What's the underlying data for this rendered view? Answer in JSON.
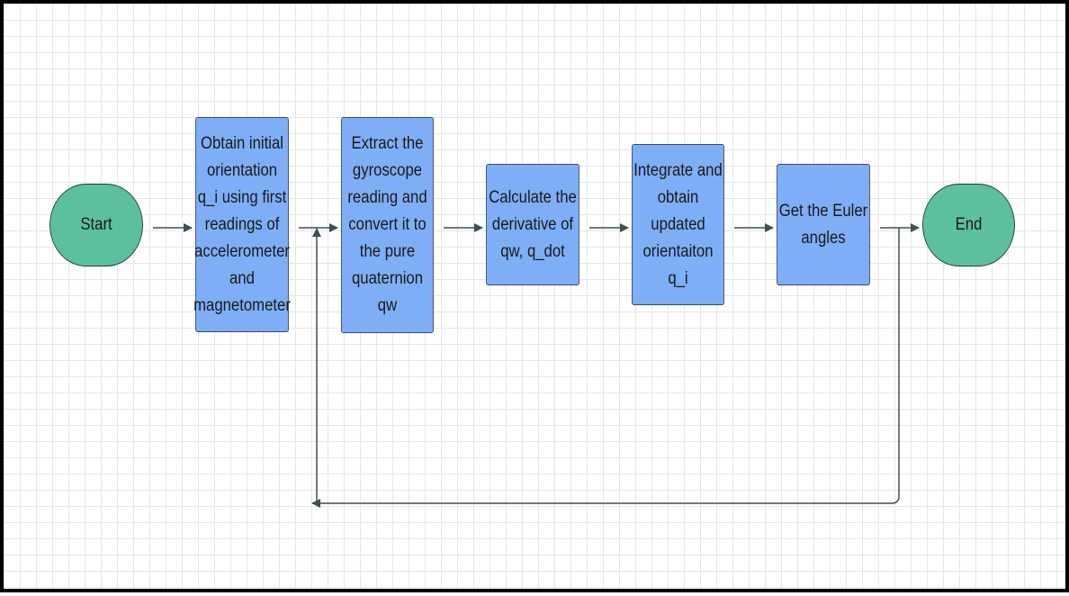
{
  "colors": {
    "terminal_fill": "#5cbf9f",
    "process_fill": "#7eaef5",
    "connector": "#3f4f55",
    "grid": "#e6e6e6"
  },
  "nodes": {
    "start": "Start",
    "step1": "Obtain initial\norientation\nq_i using first\nreadings of\naccelerometer\nand\nmagnetometer",
    "step2": "Extract the\ngyroscope\nreading and\nconvert it to\nthe pure\nquaternion\nqw",
    "step3": "Calculate the\nderivative of\nqw, q_dot",
    "step4": "Integrate and\nobtain\nupdated\norientaiton\nq_i",
    "step5": "Get the Euler\nangles",
    "end": "End"
  }
}
